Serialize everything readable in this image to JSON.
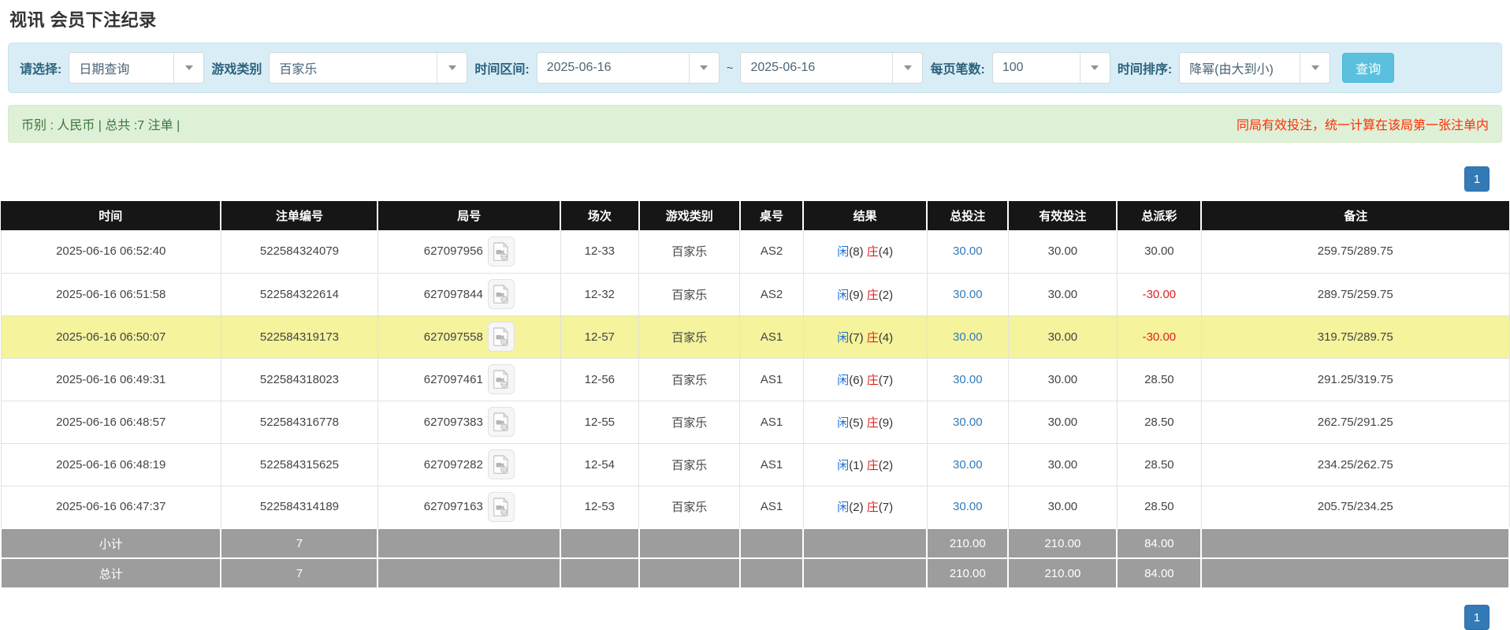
{
  "page": {
    "title": "视讯 会员下注纪录"
  },
  "filters": {
    "query_type": {
      "label": "请选择:",
      "value": "日期查询"
    },
    "game_category": {
      "label": "游戏类别",
      "value": "百家乐"
    },
    "time_range": {
      "label": "时间区间:",
      "from": "2025-06-16",
      "separator": "~",
      "to": "2025-06-16"
    },
    "page_size": {
      "label": "每页笔数:",
      "value": "100"
    },
    "time_sort": {
      "label": "时间排序:",
      "value": "降幂(由大到小)"
    },
    "search_button": "查询"
  },
  "summary": {
    "left": "币别 : 人民币 | 总共 :7 注单 |",
    "right": "同局有效投注，统一计算在该局第一张注单内"
  },
  "pagination": {
    "page": "1"
  },
  "table": {
    "headers": [
      "时间",
      "注单编号",
      "局号",
      "场次",
      "游戏类别",
      "桌号",
      "结果",
      "总投注",
      "有效投注",
      "总派彩",
      "备注"
    ],
    "rows": [
      {
        "time": "2025-06-16 06:52:40",
        "bet_id": "522584324079",
        "round_id": "627097956",
        "session": "12-33",
        "game": "百家乐",
        "table_no": "AS2",
        "result_player": "闲",
        "result_player_num": "(8)",
        "result_banker": "庄",
        "result_banker_num": "(4)",
        "total_bet": "30.00",
        "valid_bet": "30.00",
        "payout": "30.00",
        "remark": "259.75/289.75",
        "highlighted": false
      },
      {
        "time": "2025-06-16 06:51:58",
        "bet_id": "522584322614",
        "round_id": "627097844",
        "session": "12-32",
        "game": "百家乐",
        "table_no": "AS2",
        "result_player": "闲",
        "result_player_num": "(9)",
        "result_banker": "庄",
        "result_banker_num": "(2)",
        "total_bet": "30.00",
        "valid_bet": "30.00",
        "payout": "-30.00",
        "remark": "289.75/259.75",
        "highlighted": false
      },
      {
        "time": "2025-06-16 06:50:07",
        "bet_id": "522584319173",
        "round_id": "627097558",
        "session": "12-57",
        "game": "百家乐",
        "table_no": "AS1",
        "result_player": "闲",
        "result_player_num": "(7)",
        "result_banker": "庄",
        "result_banker_num": "(4)",
        "total_bet": "30.00",
        "valid_bet": "30.00",
        "payout": "-30.00",
        "remark": "319.75/289.75",
        "highlighted": true
      },
      {
        "time": "2025-06-16 06:49:31",
        "bet_id": "522584318023",
        "round_id": "627097461",
        "session": "12-56",
        "game": "百家乐",
        "table_no": "AS1",
        "result_player": "闲",
        "result_player_num": "(6)",
        "result_banker": "庄",
        "result_banker_num": "(7)",
        "total_bet": "30.00",
        "valid_bet": "30.00",
        "payout": "28.50",
        "remark": "291.25/319.75",
        "highlighted": false
      },
      {
        "time": "2025-06-16 06:48:57",
        "bet_id": "522584316778",
        "round_id": "627097383",
        "session": "12-55",
        "game": "百家乐",
        "table_no": "AS1",
        "result_player": "闲",
        "result_player_num": "(5)",
        "result_banker": "庄",
        "result_banker_num": "(9)",
        "total_bet": "30.00",
        "valid_bet": "30.00",
        "payout": "28.50",
        "remark": "262.75/291.25",
        "highlighted": false
      },
      {
        "time": "2025-06-16 06:48:19",
        "bet_id": "522584315625",
        "round_id": "627097282",
        "session": "12-54",
        "game": "百家乐",
        "table_no": "AS1",
        "result_player": "闲",
        "result_player_num": "(1)",
        "result_banker": "庄",
        "result_banker_num": "(2)",
        "total_bet": "30.00",
        "valid_bet": "30.00",
        "payout": "28.50",
        "remark": "234.25/262.75",
        "highlighted": false
      },
      {
        "time": "2025-06-16 06:47:37",
        "bet_id": "522584314189",
        "round_id": "627097163",
        "session": "12-53",
        "game": "百家乐",
        "table_no": "AS1",
        "result_player": "闲",
        "result_player_num": "(2)",
        "result_banker": "庄",
        "result_banker_num": "(7)",
        "total_bet": "30.00",
        "valid_bet": "30.00",
        "payout": "28.50",
        "remark": "205.75/234.25",
        "highlighted": false
      }
    ],
    "subtotal": {
      "label": "小计",
      "count": "7",
      "total_bet": "210.00",
      "valid_bet": "210.00",
      "payout": "84.00"
    },
    "total": {
      "label": "总计",
      "count": "7",
      "total_bet": "210.00",
      "valid_bet": "210.00",
      "payout": "84.00"
    }
  },
  "colors": {
    "accent_blue": "#337ab7",
    "query_button": "#5bc0de",
    "filter_panel_bg": "#d9edf7",
    "summary_bar_bg": "#dff0d8",
    "summary_text": "#3c763d",
    "warning_red": "#ff2d00",
    "header_bg": "#161616",
    "sum_row_bg": "#9d9d9d",
    "highlight_row": "#f5f39c",
    "player_blue": "#1b6fd8",
    "banker_red": "#e02020",
    "negative_red": "#e02020"
  }
}
